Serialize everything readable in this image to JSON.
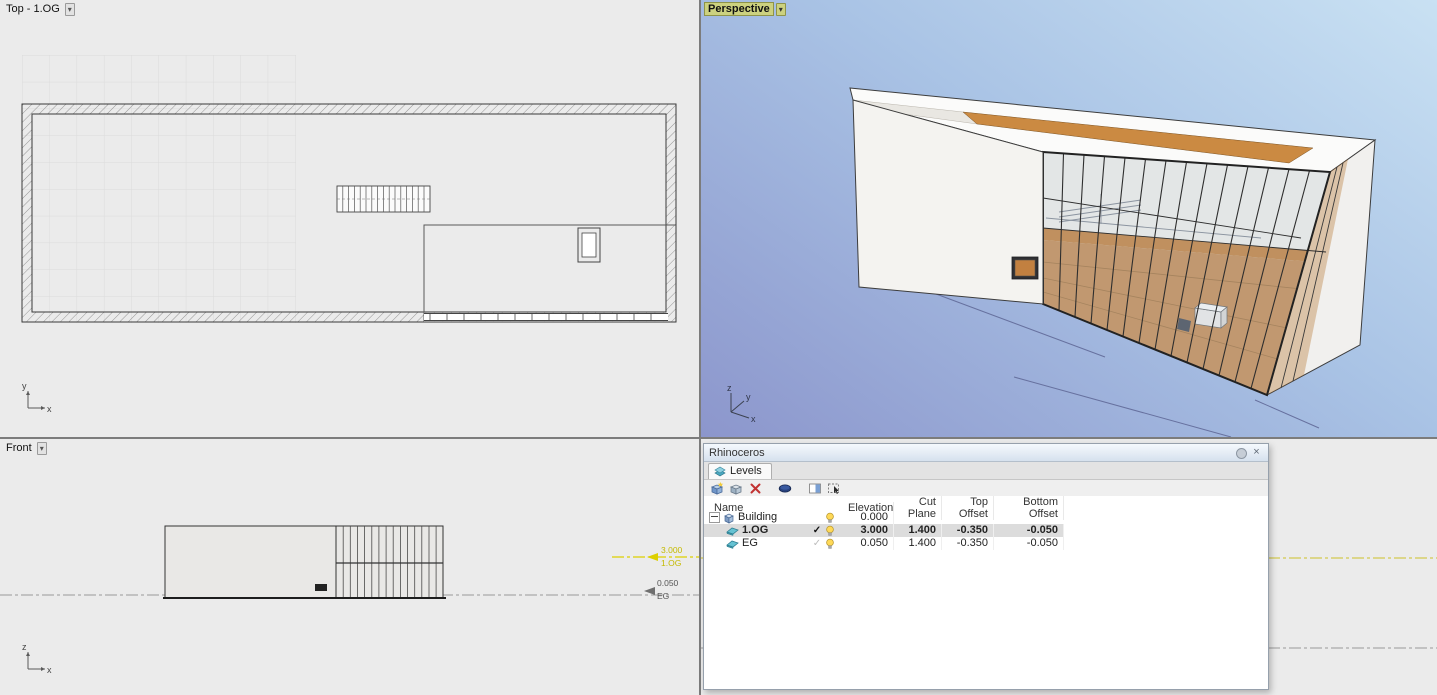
{
  "colors": {
    "selection_yellow": "#e0d300",
    "floor_orange": "#c08040",
    "viewport_background": "#ebebeb",
    "perspective_sky_top": "#c9e1f3",
    "perspective_sky_bottom": "#8c96cc",
    "active_label_background": "#ccd17f"
  },
  "glyphs": {
    "dropdown": "▾",
    "close": "×",
    "check": "✓"
  },
  "viewports": {
    "top": {
      "label": "Top - 1.OG"
    },
    "perspective": {
      "label": "Perspective"
    },
    "front": {
      "label": "Front"
    }
  },
  "axis": {
    "x": "x",
    "y": "y",
    "z": "z"
  },
  "levels_markers": {
    "og": {
      "elevation": "3.000",
      "name": "1.OG"
    },
    "eg": {
      "elevation": "0.050",
      "name": "EG"
    }
  },
  "panel": {
    "title": "Rhinoceros",
    "tab": "Levels",
    "toolbar": {
      "icons": [
        "new-level-icon",
        "new-sublevel-icon",
        "delete-level-icon",
        "cut-plane-icon",
        "panel-list-icon",
        "select-objects-icon"
      ]
    },
    "columns": {
      "name": "Name",
      "elevation": "Elevation",
      "cut_plane": "Cut Plane",
      "top_offset": "Top Offset",
      "bottom_offset": "Bottom Offset"
    },
    "rows": [
      {
        "name": "Building",
        "elevation": "0.000",
        "cut_plane": "",
        "top_offset": "",
        "bottom_offset": ""
      },
      {
        "name": "1.OG",
        "elevation": "3.000",
        "cut_plane": "1.400",
        "top_offset": "-0.350",
        "bottom_offset": "-0.050"
      },
      {
        "name": "EG",
        "elevation": "0.050",
        "cut_plane": "1.400",
        "top_offset": "-0.350",
        "bottom_offset": "-0.050"
      }
    ]
  }
}
